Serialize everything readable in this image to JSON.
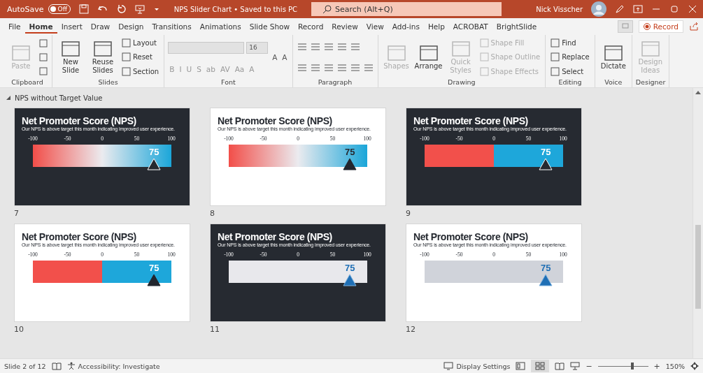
{
  "titlebar": {
    "autosave_label": "AutoSave",
    "autosave_toggle": {
      "label": "Off",
      "on": false
    },
    "document_title": "NPS Slider Chart • Saved to this PC",
    "search": {
      "placeholder": "Search (Alt+Q)"
    },
    "user_name": "Nick Visscher"
  },
  "tabs": [
    {
      "label": "File",
      "selected": false
    },
    {
      "label": "Home",
      "selected": true
    },
    {
      "label": "Insert",
      "selected": false
    },
    {
      "label": "Draw",
      "selected": false
    },
    {
      "label": "Design",
      "selected": false
    },
    {
      "label": "Transitions",
      "selected": false
    },
    {
      "label": "Animations",
      "selected": false
    },
    {
      "label": "Slide Show",
      "selected": false
    },
    {
      "label": "Record",
      "selected": false
    },
    {
      "label": "Review",
      "selected": false
    },
    {
      "label": "View",
      "selected": false
    },
    {
      "label": "Add-ins",
      "selected": false
    },
    {
      "label": "Help",
      "selected": false
    },
    {
      "label": "ACROBAT",
      "selected": false
    },
    {
      "label": "BrightSlide",
      "selected": false
    }
  ],
  "record_button": {
    "label": "Record"
  },
  "ribbon_groups": [
    {
      "label": "Clipboard",
      "columns": [
        [
          {
            "kind": "large",
            "label": "Paste",
            "disabled": true
          }
        ],
        [
          {
            "kind": "icon",
            "disabled": false
          },
          {
            "kind": "icon",
            "disabled": false
          },
          {
            "kind": "icon",
            "disabled": false
          }
        ]
      ]
    },
    {
      "label": "Slides",
      "columns": [
        [
          {
            "kind": "large",
            "label": "New Slide",
            "disabled": false
          }
        ],
        [
          {
            "kind": "large",
            "label": "Reuse Slides",
            "disabled": false
          }
        ],
        [
          {
            "kind": "small",
            "label": "Layout",
            "disabled": false
          },
          {
            "kind": "small",
            "label": "Reset",
            "disabled": false
          },
          {
            "kind": "small",
            "label": "Section",
            "disabled": false
          }
        ]
      ]
    },
    {
      "label": "Font",
      "columns": [
        [
          {
            "kind": "field",
            "value": "16",
            "disabled": true
          },
          {
            "kind": "glyphs",
            "glyphs": [
              "B",
              "I",
              "U",
              "S",
              "ab",
              "AV",
              "Aa",
              "A"
            ],
            "disabled": true
          }
        ],
        [
          {
            "kind": "glyphs",
            "glyphs": [
              "A",
              "A"
            ],
            "disabled": false
          }
        ]
      ]
    },
    {
      "label": "Paragraph",
      "columns": [
        [
          {
            "kind": "listicons",
            "disabled": false
          },
          {
            "kind": "alignicons",
            "disabled": false
          }
        ]
      ]
    },
    {
      "label": "Drawing",
      "columns": [
        [
          {
            "kind": "large",
            "label": "Shapes",
            "disabled": true
          }
        ],
        [
          {
            "kind": "large",
            "label": "Arrange",
            "disabled": false
          }
        ],
        [
          {
            "kind": "large",
            "label": "Quick Styles",
            "disabled": true
          }
        ],
        [
          {
            "kind": "small",
            "label": "Shape Fill",
            "disabled": true
          },
          {
            "kind": "small",
            "label": "Shape Outline",
            "disabled": true
          },
          {
            "kind": "small",
            "label": "Shape Effects",
            "disabled": true
          }
        ]
      ]
    },
    {
      "label": "Editing",
      "columns": [
        [
          {
            "kind": "small",
            "label": "Find",
            "disabled": false
          },
          {
            "kind": "small",
            "label": "Replace",
            "disabled": false
          },
          {
            "kind": "small",
            "label": "Select",
            "disabled": false
          }
        ]
      ]
    },
    {
      "label": "Voice",
      "columns": [
        [
          {
            "kind": "large",
            "label": "Dictate",
            "disabled": false
          }
        ]
      ]
    },
    {
      "label": "Designer",
      "columns": [
        [
          {
            "kind": "large",
            "label": "Design Ideas",
            "disabled": true
          }
        ]
      ]
    }
  ],
  "section": {
    "title": "NPS without Target Value",
    "expanded": true
  },
  "slides": [
    {
      "number": "7",
      "dark": true,
      "kind": "gradient",
      "title": "Net Promoter Score (NPS)",
      "subtitle": "Our NPS is above target this month indicating improved user experience.",
      "ticks": [
        "-100",
        "-50",
        "0",
        "50",
        "100"
      ],
      "value": "75",
      "level": 0.875
    },
    {
      "number": "8",
      "dark": false,
      "kind": "gradient",
      "title": "Net Promoter Score (NPS)",
      "subtitle": "Our NPS is above target this month indicating improved user experience.",
      "ticks": [
        "-100",
        "-50",
        "0",
        "50",
        "100"
      ],
      "value": "75",
      "level": 0.875
    },
    {
      "number": "9",
      "dark": true,
      "kind": "split",
      "title": "Net Promoter Score (NPS)",
      "subtitle": "Our NPS is above target this month indicating improved user experience.",
      "ticks": [
        "-100",
        "-50",
        "0",
        "50",
        "100"
      ],
      "value": "75",
      "level": 0.875
    },
    {
      "number": "10",
      "dark": false,
      "kind": "split",
      "title": "Net Promoter Score (NPS)",
      "subtitle": "Our NPS is above target this month indicating improved user experience.",
      "ticks": [
        "-100",
        "-50",
        "0",
        "50",
        "100"
      ],
      "value": "75",
      "level": 0.875
    },
    {
      "number": "11",
      "dark": true,
      "kind": "flat",
      "title": "Net Promoter Score (NPS)",
      "subtitle": "Our NPS is above target this month indicating improved user experience.",
      "ticks": [
        "-100",
        "-50",
        "0",
        "50",
        "100"
      ],
      "value": "75",
      "level": 0.875
    },
    {
      "number": "12",
      "dark": false,
      "kind": "flat",
      "title": "Net Promoter Score (NPS)",
      "subtitle": "Our NPS is above target this month indicating improved user experience.",
      "ticks": [
        "-100",
        "-50",
        "0",
        "50",
        "100"
      ],
      "value": "75",
      "level": 0.875
    }
  ],
  "status_bar": {
    "slide_info": "Slide 2 of 12",
    "accessibility": "Accessibility: Investigate",
    "display_settings": "Display Settings",
    "zoom": {
      "zoom_out": "−",
      "level": 0.68,
      "zoom_in": "+",
      "reading": "150%"
    }
  }
}
